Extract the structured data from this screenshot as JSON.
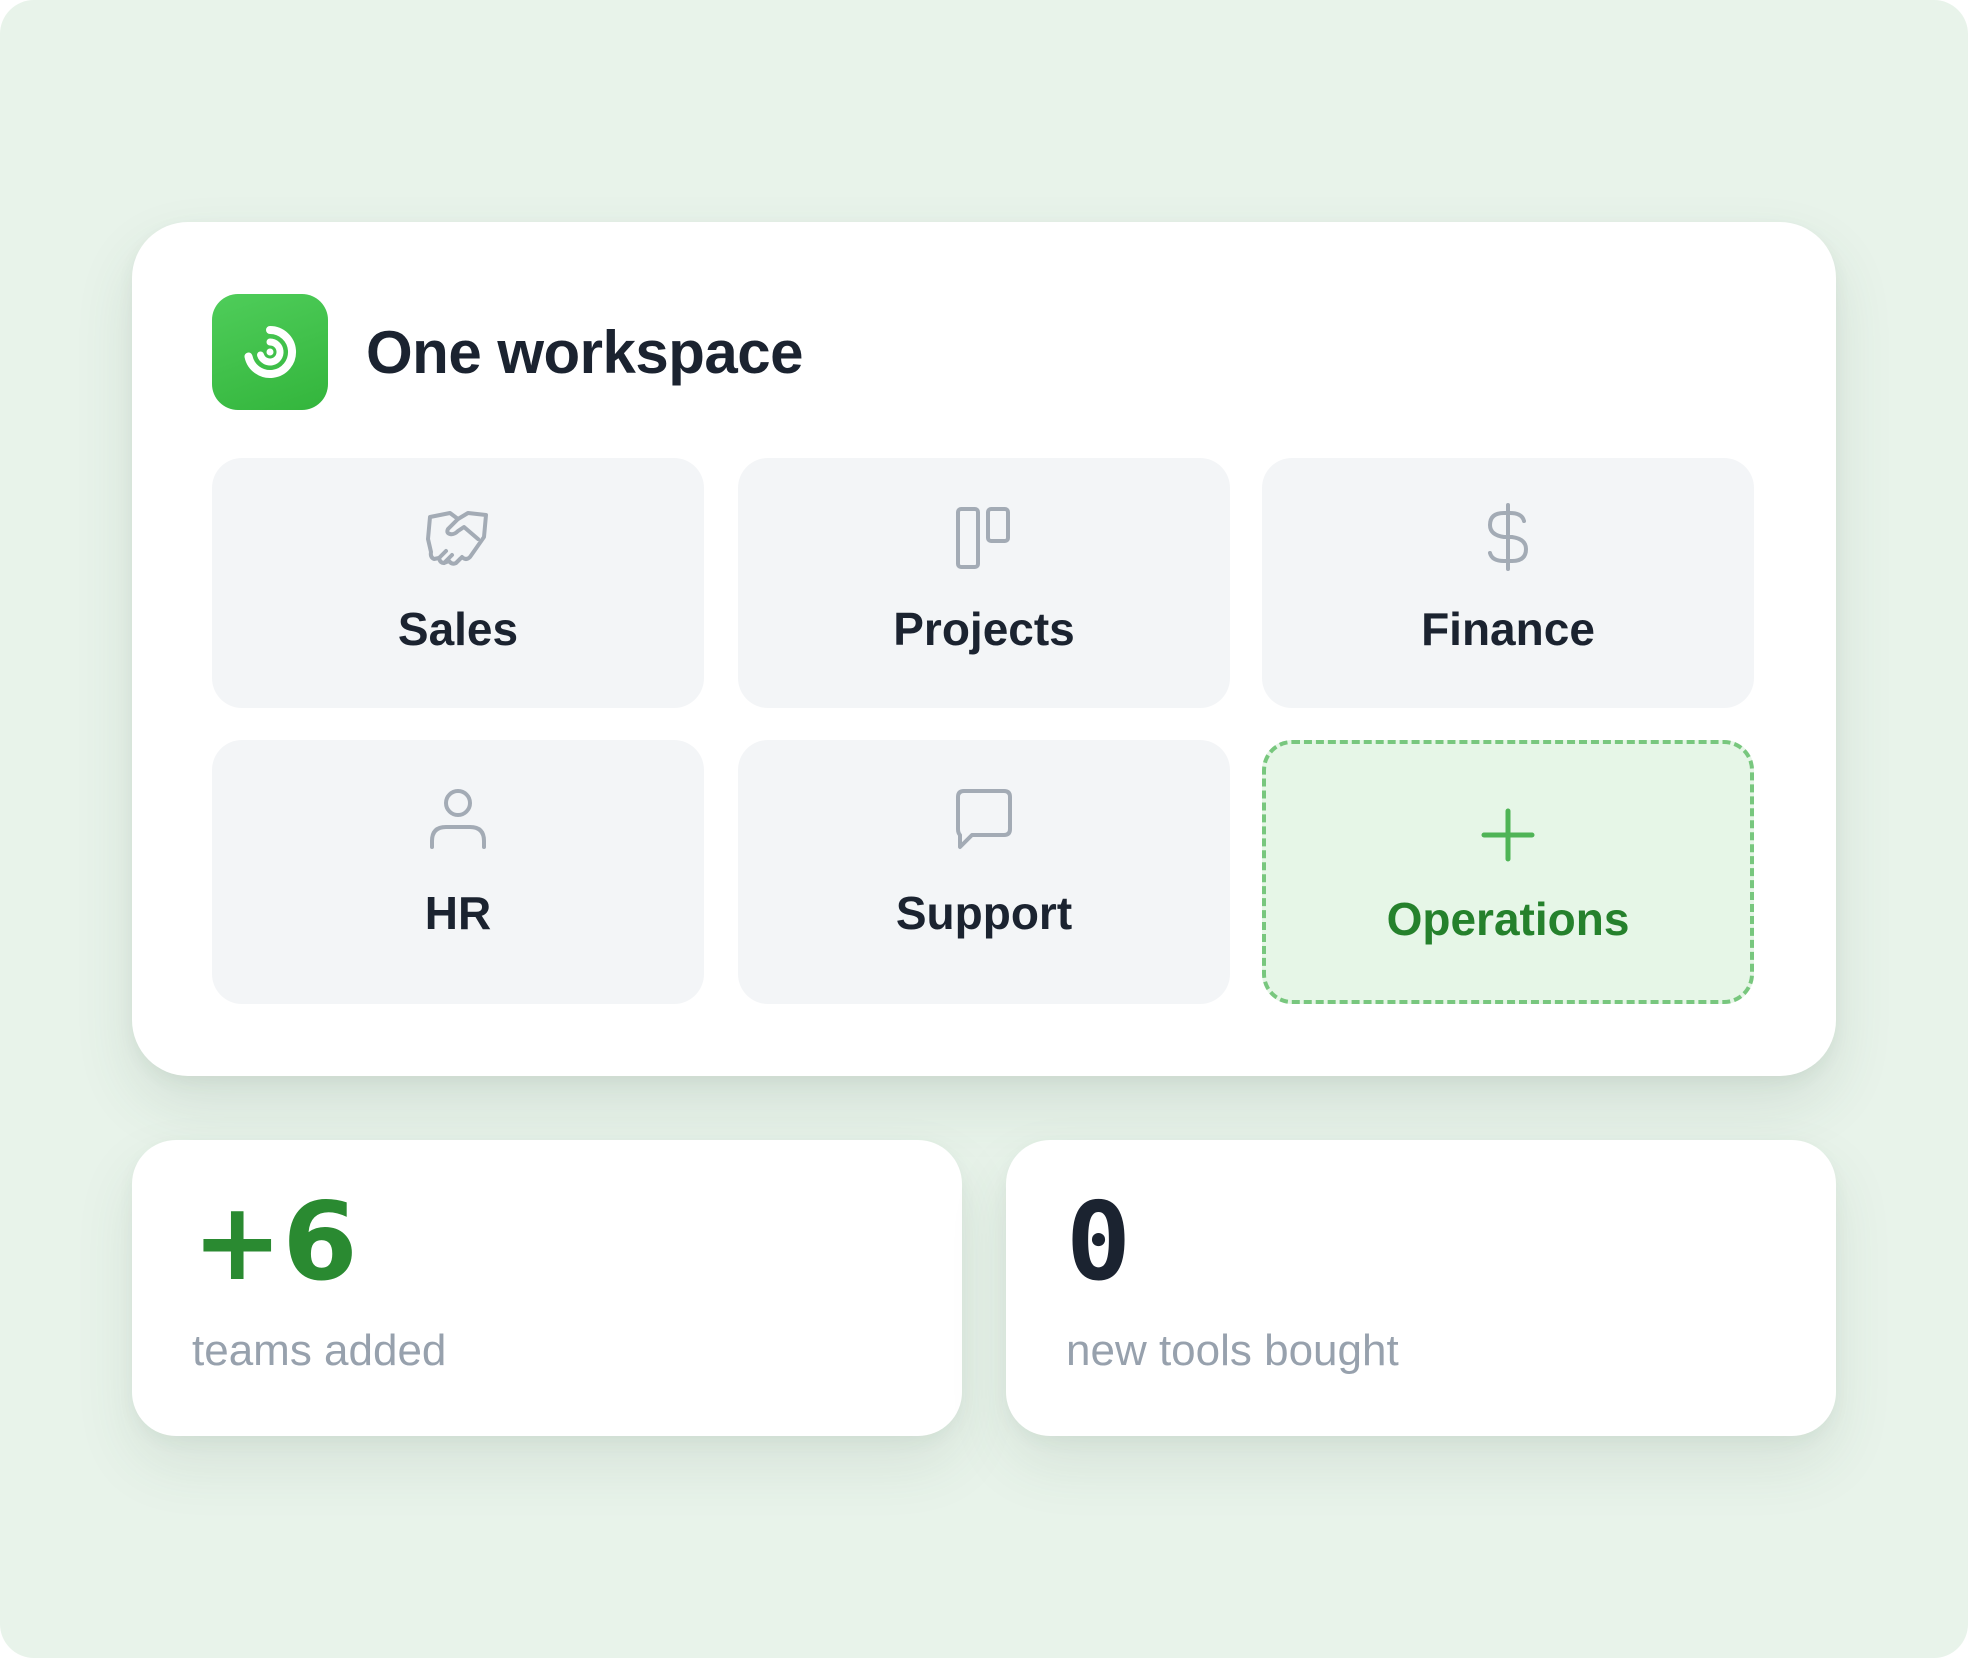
{
  "workspace": {
    "title": "One workspace",
    "logo_icon": "spiral-logo-icon",
    "brand_color": "#3cbf46"
  },
  "tiles": [
    {
      "label": "Sales",
      "icon": "handshake-icon"
    },
    {
      "label": "Projects",
      "icon": "kanban-board-icon"
    },
    {
      "label": "Finance",
      "icon": "dollar-icon"
    },
    {
      "label": "HR",
      "icon": "person-icon"
    },
    {
      "label": "Support",
      "icon": "chat-bubble-icon"
    },
    {
      "label": "Operations",
      "icon": "plus-icon",
      "state": "add-new"
    }
  ],
  "stats": [
    {
      "value": "+6",
      "caption": "teams added",
      "color": "#2a8a31"
    },
    {
      "value": "0",
      "caption": "new tools bought",
      "color": "#1b2330"
    }
  ],
  "colors": {
    "background": "#e8f3ea",
    "tile_background": "#f3f5f7",
    "add_tile_background": "#e6f6e7",
    "add_tile_border": "#78c77e",
    "accent_green": "#25812c",
    "text_dark": "#1b2330",
    "text_muted": "#97a1ad",
    "icon_gray": "#a3abb5"
  }
}
